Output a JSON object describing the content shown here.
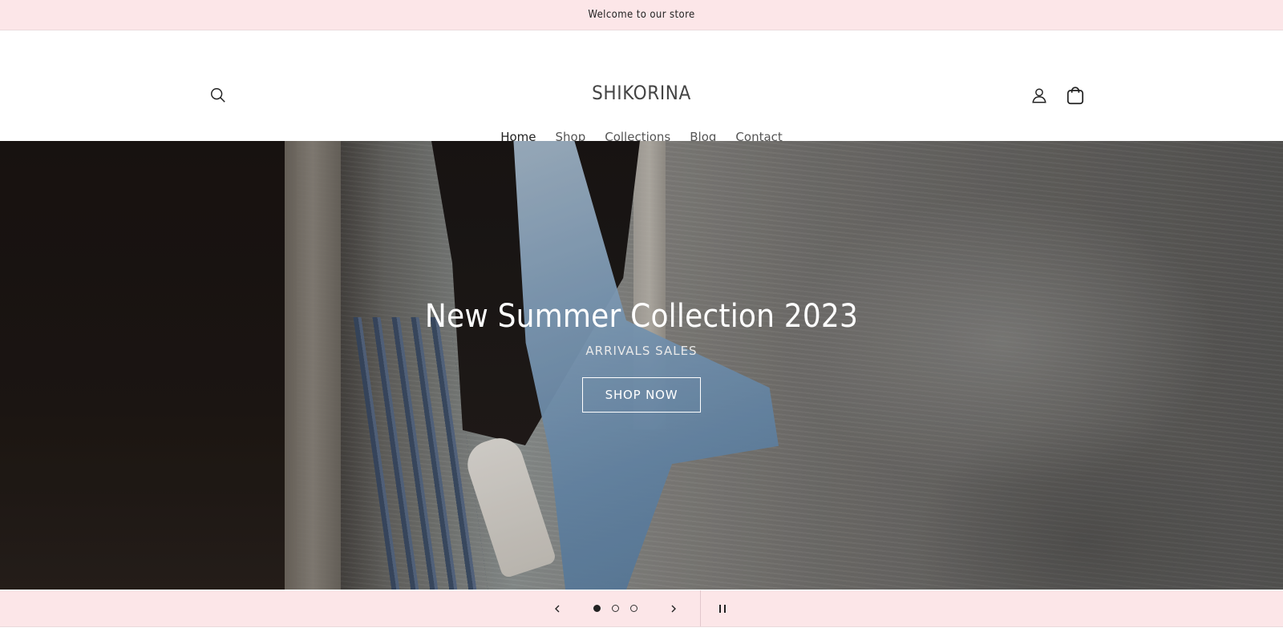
{
  "announcement": {
    "text": "Welcome to our store"
  },
  "header": {
    "logo": "SHIKORINA",
    "search_icon": "search-icon",
    "account_icon": "user-icon",
    "cart_icon": "shopping-bag-icon",
    "nav": [
      {
        "label": "Home",
        "active": true
      },
      {
        "label": "Shop",
        "active": false
      },
      {
        "label": "Collections",
        "active": false
      },
      {
        "label": "Blog",
        "active": false
      },
      {
        "label": "Contact",
        "active": false
      }
    ]
  },
  "hero": {
    "title": "New Summer Collection 2023",
    "subtitle": "ARRIVALS SALES",
    "button_label": "SHOP NOW"
  },
  "slider": {
    "prev_icon": "chevron-left-icon",
    "next_icon": "chevron-right-icon",
    "pause_icon": "pause-icon",
    "slides_total": 3,
    "active_slide": 1
  },
  "colors": {
    "announcement_bg": "#fce6e8",
    "slider_bg": "#fce6e8",
    "text": "#333333"
  }
}
